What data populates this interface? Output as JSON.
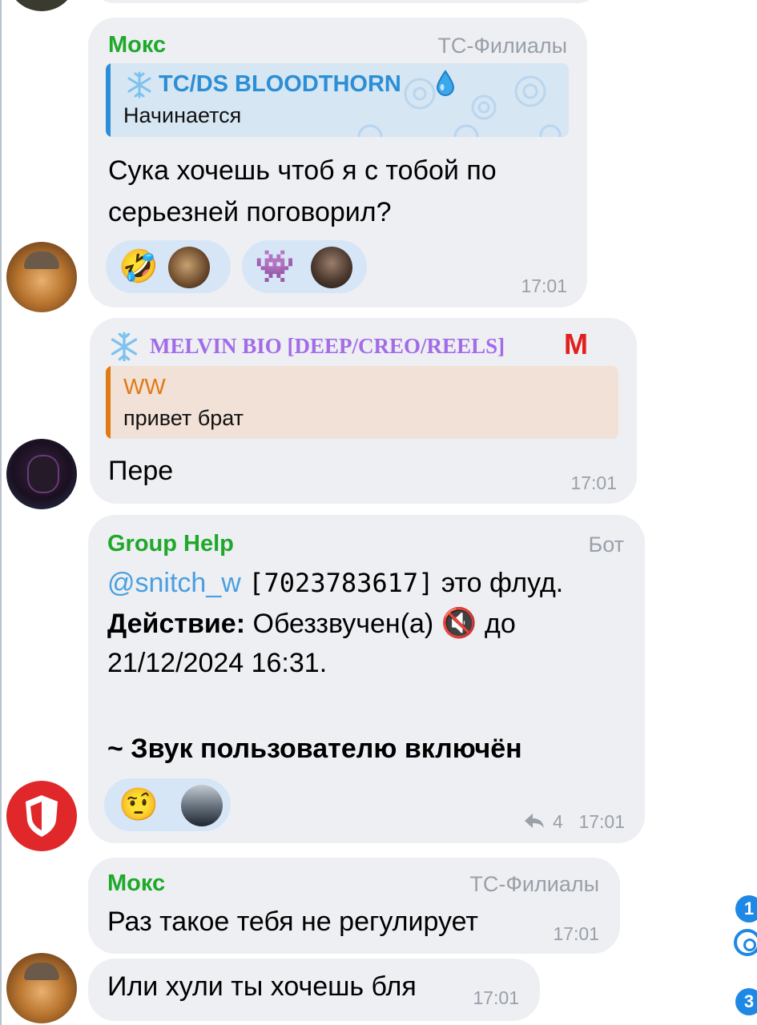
{
  "colors": {
    "bubble": "#edeff3",
    "sender_green": "#1fa82a",
    "quote_blue": "#2b8ed6",
    "quote_orange": "#e07a12",
    "purple_name": "#a36be8",
    "role_gray": "#9aa0a8",
    "reaction_bg": "#d6e6f6"
  },
  "messages": [
    {
      "sender": "Мокс",
      "role": "ТС-Филиалы",
      "reply": {
        "name": "TC/DS BLOODTHORN",
        "text": "Начинается",
        "prefix_icon": "snowflake-icon",
        "suffix_icon": "water-drop-icon"
      },
      "lines": [
        "Сука хочешь чтоб я с тобой по",
        "серьезней поговорил?"
      ],
      "reactions": [
        {
          "emoji": "🤣",
          "emoji_name": "rolling-laughing-emoji"
        },
        {
          "emoji": "👾",
          "emoji_name": "space-invader-emoji"
        }
      ],
      "time": "17:01"
    },
    {
      "sender": "MELVIN BIO [DEEP/CREO/REELS]",
      "sender_badge": "M",
      "reply": {
        "name": "WW",
        "text": "привет брат"
      },
      "text": "Пере",
      "time": "17:01"
    },
    {
      "sender": "Group Help",
      "role": "Бот",
      "mention": "@snitch_w",
      "id_text": "[7023783617]",
      "after_id": " это флуд.",
      "action_label": "Действие:",
      "action_text": " Обеззвучен(а)",
      "muted_icon": "🔇",
      "until_text": " до",
      "date_line": "21/12/2024 16:31.",
      "unmute_line": "~ Звук пользователю включён",
      "reactions": [
        {
          "emoji": "🤨",
          "emoji_name": "raised-eyebrow-emoji"
        }
      ],
      "replies_count": "4",
      "time": "17:01"
    },
    {
      "sender": "Мокс",
      "role": "ТС-Филиалы",
      "text": "Раз такое тебя не регулирует",
      "time": "17:01"
    },
    {
      "text": "Или хули ты хочешь бля",
      "time": "17:01"
    }
  ],
  "side_badges": [
    "1",
    "3"
  ]
}
